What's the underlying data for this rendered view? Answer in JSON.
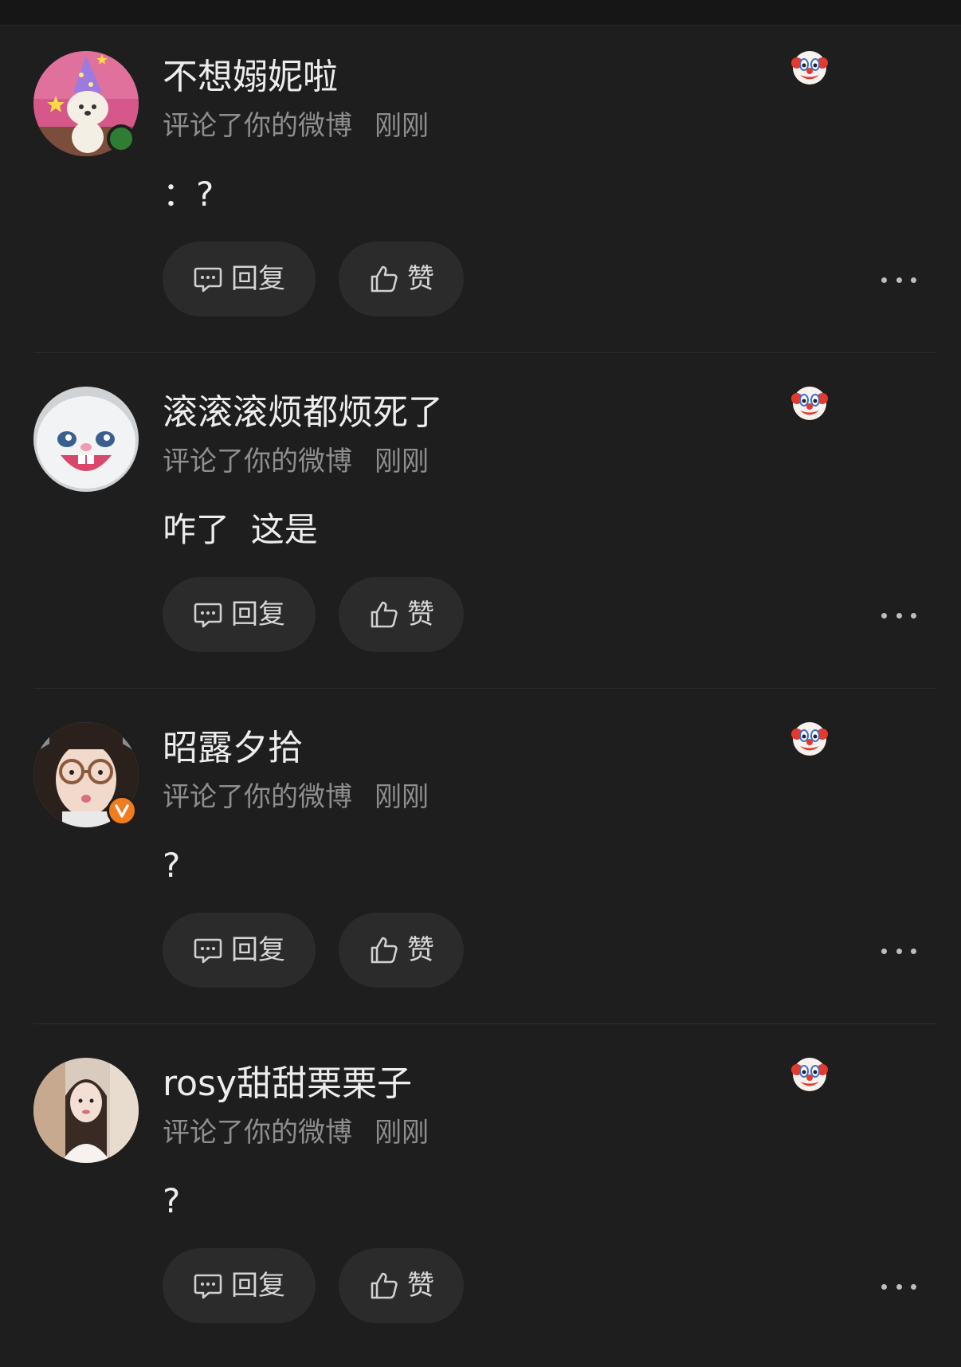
{
  "comments": [
    {
      "username": "不想嫋妮啦",
      "action": "评论了你的微博",
      "time": "刚刚",
      "text": "：?",
      "reaction_icon": "clown-face-icon",
      "badge": "online",
      "reply_label": "回复",
      "like_label": "赞"
    },
    {
      "username": "滚滚滚烦都烦死了",
      "action": "评论了你的微博",
      "time": "刚刚",
      "text": "咋了  这是",
      "reaction_icon": "clown-face-icon",
      "badge": "none",
      "reply_label": "回复",
      "like_label": "赞"
    },
    {
      "username": "昭露夕拾",
      "action": "评论了你的微博",
      "time": "刚刚",
      "text": "?",
      "reaction_icon": "clown-face-icon",
      "badge": "verified-v",
      "reply_label": "回复",
      "like_label": "赞"
    },
    {
      "username": "rosy甜甜栗栗子",
      "action": "评论了你的微博",
      "time": "刚刚",
      "text": "?",
      "reaction_icon": "clown-face-icon",
      "badge": "none",
      "reply_label": "回复",
      "like_label": "赞"
    }
  ],
  "colors": {
    "background": "#1e1e1e",
    "button_bg": "#2b2b2b",
    "online": "#2e7d32",
    "verified": "#f07c1f"
  }
}
